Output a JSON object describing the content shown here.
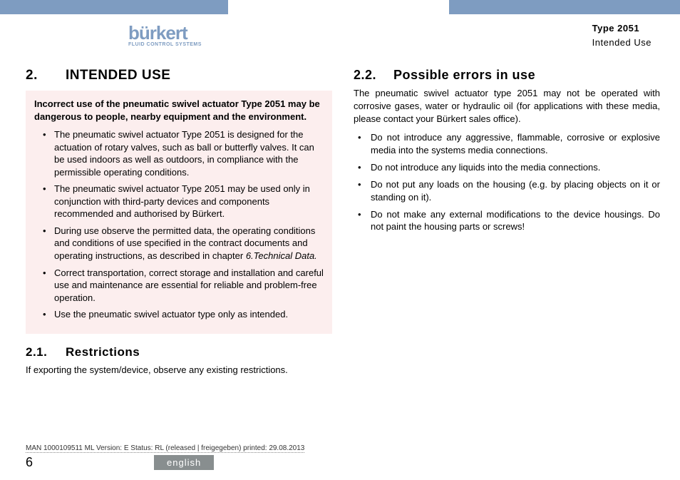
{
  "header": {
    "logo_brand": "burkert",
    "logo_tag": "FLUID CONTROL SYSTEMS",
    "type_label": "Type 2051",
    "section_label": "Intended Use"
  },
  "left": {
    "section_num": "2.",
    "section_title": "INTENDED USE",
    "warning_lead": "Incorrect use of the pneumatic swivel actuator Type 2051 may be dangerous to people, nearby equipment and the environment.",
    "warning_items": [
      "The pneumatic swivel actuator Type 2051 is designed for the actuation of rotary valves, such as ball or butterfly valves. It can be used indoors as well as outdoors, in compliance with the permissible operating conditions.",
      "The pneumatic swivel actuator Type 2051 may be used only in conjunction with third-party devices and components recommended and authorised by Bürkert.",
      "During use observe the permitted data, the operating conditions and conditions of use specified in the contract documents and operating instructions, as described in chapter 6.Technical Data.",
      "Correct transportation, correct storage and installation and careful use and maintenance are essential for reliable and problem-free operation.",
      "Use the pneumatic swivel actuator type only as intended."
    ],
    "sub1_num": "2.1.",
    "sub1_title": "Restrictions",
    "sub1_body": "If exporting the system/device, observe any existing restrictions."
  },
  "right": {
    "sub2_num": "2.2.",
    "sub2_title": "Possible errors in use",
    "sub2_intro": "The pneumatic swivel actuator type 2051 may not be operated with corrosive gases, water or hydraulic oil (for applications with these media, please contact your Bürkert sales office).",
    "sub2_items": [
      "Do not introduce any aggressive, flammable, corrosive or explosive media into the systems media connections.",
      "Do not introduce any liquids into the media connections.",
      "Do not put any loads on the housing (e.g. by placing objects on it or standing on it).",
      "Do not make any external modifications to the device housings. Do not paint the housing parts or screws!"
    ]
  },
  "footer": {
    "meta": "MAN  1000109511  ML  Version: E Status: RL (released | freigegeben)  printed: 29.08.2013",
    "page_num": "6",
    "language": "english"
  }
}
